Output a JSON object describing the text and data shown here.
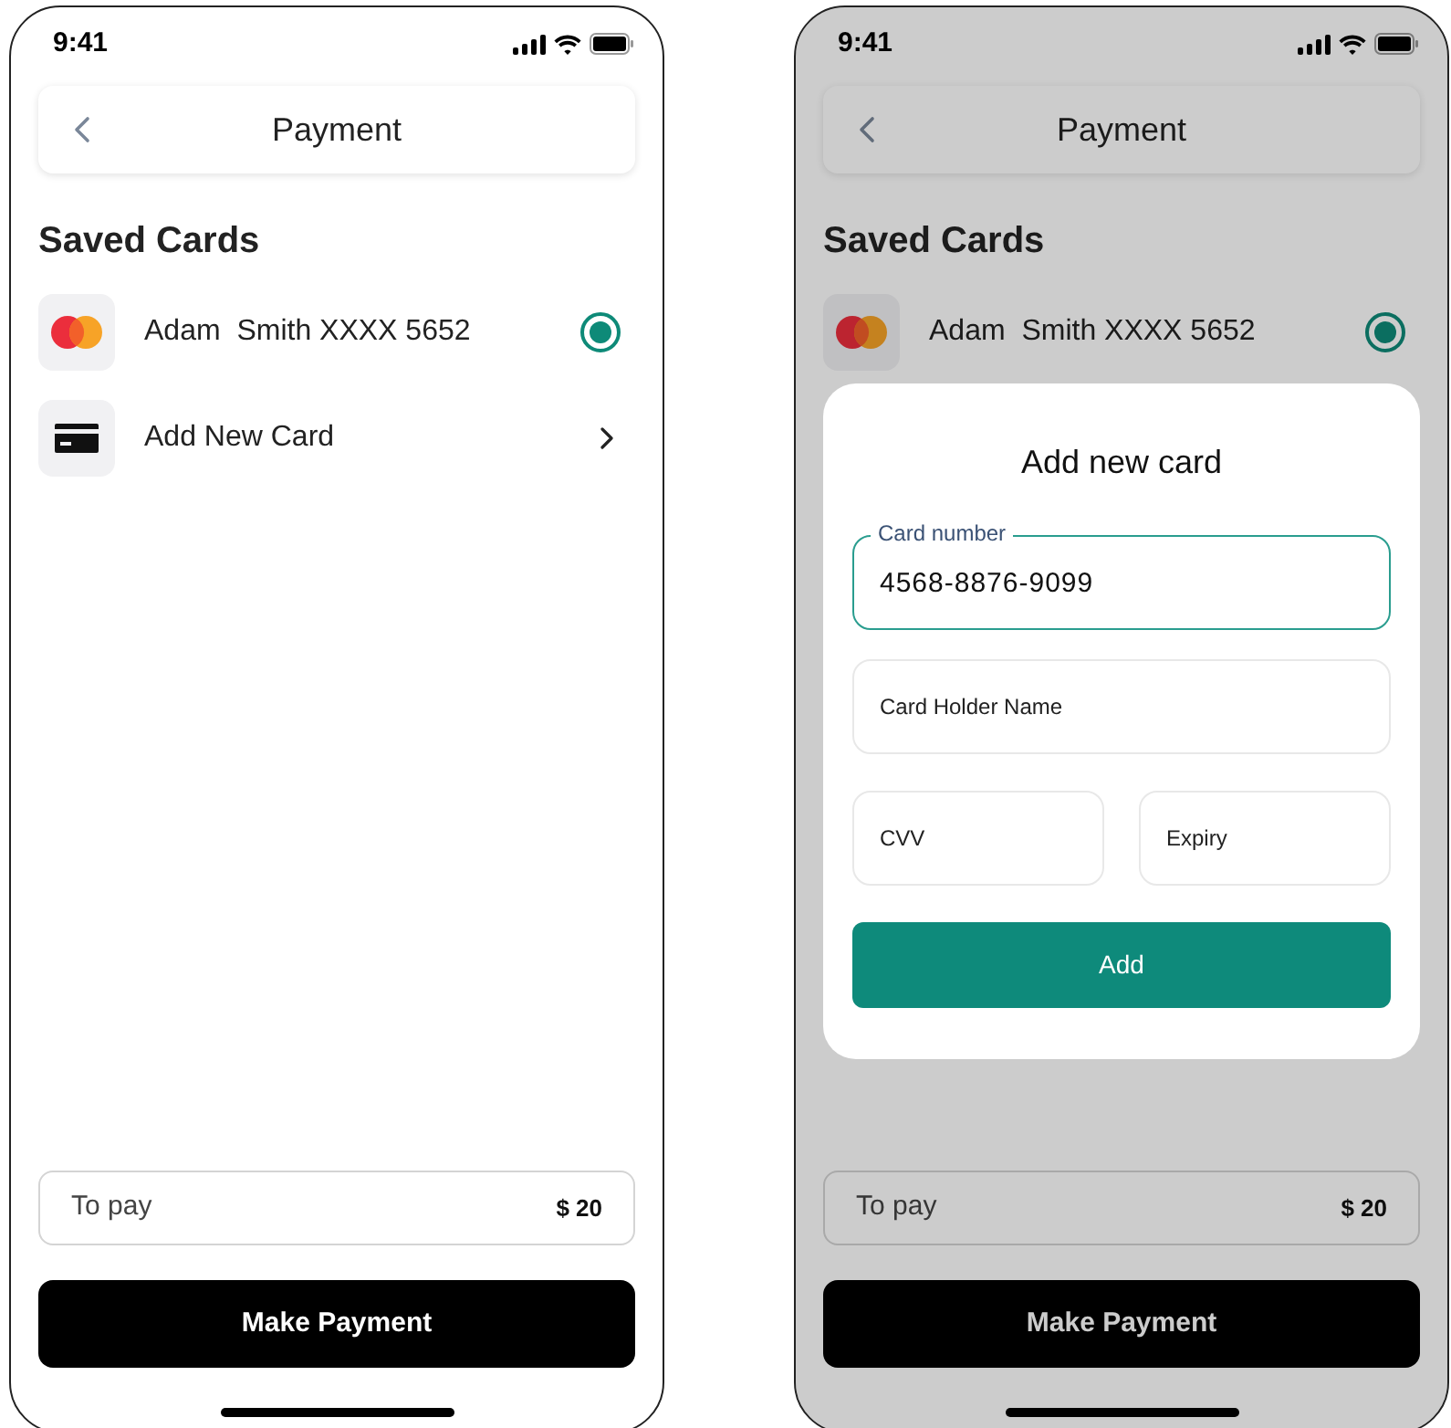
{
  "screens": [
    {
      "status_time": "9:41",
      "title": "Payment",
      "section_title": "Saved Cards",
      "dimmed": false,
      "cards": [
        {
          "kind": "saved",
          "label": "Adam  Smith XXXX 5652",
          "selected": true
        },
        {
          "kind": "add",
          "label": "Add New Card"
        }
      ],
      "summary": {
        "label": "To pay",
        "amount": "$ 20"
      },
      "action": "Make Payment"
    },
    {
      "status_time": "9:41",
      "title": "Payment",
      "section_title": "Saved Cards",
      "dimmed": true,
      "cards": [
        {
          "kind": "saved",
          "label": "Adam  Smith XXXX 5652",
          "selected": true
        }
      ],
      "summary": {
        "label": "To pay",
        "amount": "$ 20"
      },
      "action": "Make Payment",
      "modal": {
        "title": "Add new card",
        "fields": [
          {
            "label": "Card number",
            "value": "4568-8876-9099",
            "focused": true
          },
          {
            "placeholder": "Card Holder Name",
            "focused": false
          },
          {
            "placeholder": "CVV",
            "focused": false
          },
          {
            "placeholder": "Expiry",
            "focused": false
          }
        ],
        "button": "Add"
      }
    }
  ]
}
